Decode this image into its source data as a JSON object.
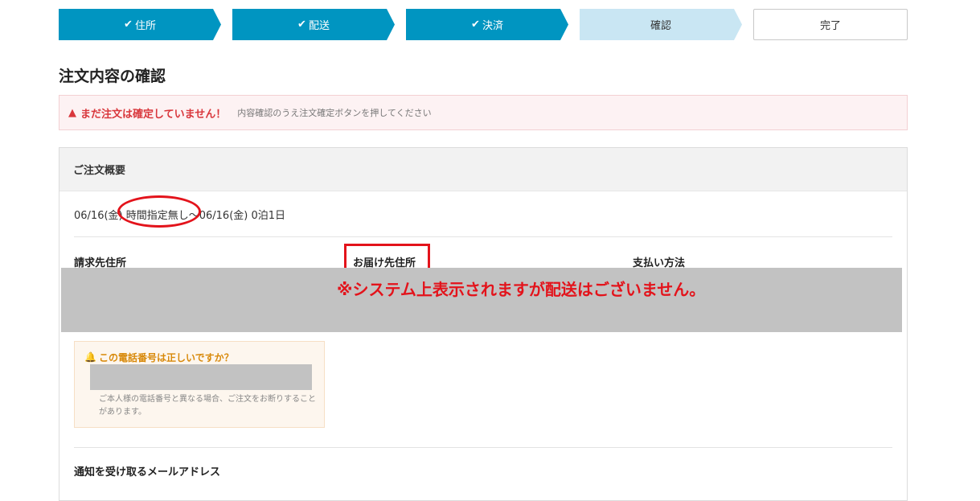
{
  "steps": [
    {
      "check": "✔",
      "label": "住所"
    },
    {
      "check": "✔",
      "label": "配送"
    },
    {
      "check": "✔",
      "label": "決済"
    },
    {
      "label": "確認"
    },
    {
      "label": "完了"
    }
  ],
  "page_title": "注文内容の確認",
  "alert": {
    "icon": "warning-icon",
    "strong": "まだ注文は確定していません！",
    "message": "内容確認のうえ注文確定ボタンを押してください"
  },
  "summary": {
    "header": "ご注文概要",
    "delivery": "06/16(金) 時間指定無し～06/16(金) 0泊1日",
    "columns": {
      "billing": "請求先住所",
      "shipping": "お届け先住所",
      "payment": "支払い方法"
    },
    "annotation": "※システム上表示されますが配送はございません。",
    "phone_check": {
      "icon": "bell-icon",
      "question": "この電話番号は正しいですか？",
      "note": "ご本人様の電話番号と異なる場合、ご注文をお断りすることがあります。"
    },
    "email_header": "通知を受け取るメールアドレス"
  }
}
